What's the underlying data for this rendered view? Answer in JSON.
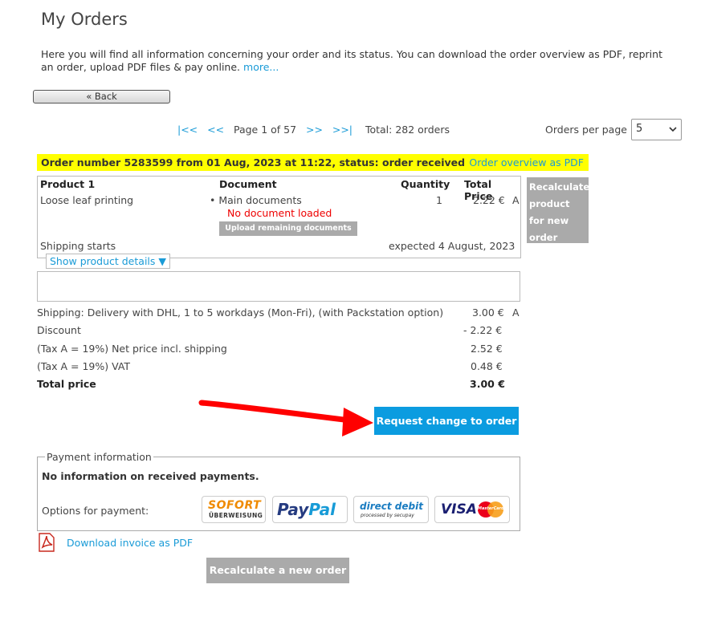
{
  "page": {
    "title": "My Orders",
    "intro": "Here you will find all information concerning your order and its status. You can download the order overview as PDF, reprint an order, upload PDF files & pay online.",
    "more_link": "more..."
  },
  "back_label": "« Back",
  "pager": {
    "first": "|<<",
    "prev": "<<",
    "page_text": "Page 1 of 57",
    "next": ">>",
    "last": ">>|",
    "total": "Total: 282 orders",
    "per_page_label": "Orders per page",
    "per_page_value": "5"
  },
  "order": {
    "header": "Order number 5283599 from 01 Aug, 2023 at 11:22, status: order received",
    "overview_pdf": "Order overview as PDF",
    "columns": {
      "product": "Product 1",
      "document": "Document",
      "quantity": "Quantity",
      "total_price": "Total Price"
    },
    "item": {
      "product": "Loose leaf printing",
      "document": "Main documents",
      "doc_status": "No document loaded",
      "upload_btn": "Upload remaining documents",
      "quantity": "1",
      "price": "2.22 €",
      "tax_code": "A"
    },
    "shipping_starts_label": "Shipping starts",
    "shipping_expected": "expected 4 August, 2023",
    "show_details": "Show product details ▼",
    "recalc_product": "Recalculate product for new order"
  },
  "summary": [
    {
      "label": "Shipping:  Delivery with DHL, 1 to 5 workdays (Mon-Fri), (with Packstation option)",
      "value": "3.00 €",
      "code": "A"
    },
    {
      "label": "Discount",
      "value": "- 2.22 €",
      "code": ""
    },
    {
      "label": "(Tax A = 19%) Net price incl. shipping",
      "value": "2.52 €",
      "code": ""
    },
    {
      "label": "(Tax A = 19%) VAT",
      "value": "0.48 €",
      "code": ""
    },
    {
      "label": "Total price",
      "value": "3.00 €",
      "code": ""
    }
  ],
  "request_change": "Request change to order",
  "payment": {
    "legend": "Payment information",
    "status": "No information on received payments.",
    "options_label": "Options for payment:",
    "logos": {
      "sofort_top": "SOFORT",
      "sofort_bottom": "ÜBERWEISUNG",
      "paypal_a": "Pay",
      "paypal_b": "Pal",
      "dd_top": "direct debit",
      "dd_bottom": "processed by secupay",
      "visa": "VISA",
      "mastercard": "MasterCard"
    }
  },
  "download_invoice": "Download invoice as PDF",
  "recalc_new_order": "Recalculate a new order",
  "colors": {
    "accent": "#1a9bd7",
    "highlight": "#ffff00",
    "error": "#ee0000",
    "button_blue": "#0b9ce0",
    "button_gray": "#aaaaaa",
    "arrow_red": "#ff0000"
  }
}
